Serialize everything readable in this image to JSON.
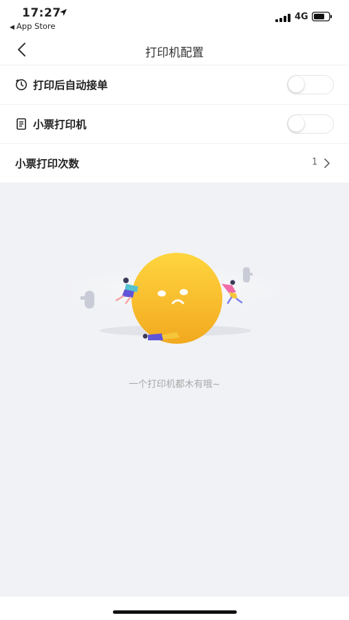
{
  "status": {
    "time": "17:27",
    "back_app": "App Store",
    "network": "4G"
  },
  "nav": {
    "title": "打印机配置"
  },
  "rows": [
    {
      "label": "打印后自动接单",
      "icon": "clock-icon",
      "type": "toggle",
      "on": false
    },
    {
      "label": "小票打印机",
      "icon": "receipt-icon",
      "type": "toggle",
      "on": false
    },
    {
      "label": "小票打印次数",
      "type": "value",
      "value": "1"
    }
  ],
  "empty_state": {
    "message": "一个打印机都木有哦~",
    "illustration": "sad-face-pushing-people-illustration"
  },
  "colors": {
    "accent_yellow": "#f6b92a",
    "background_gray": "#f1f2f5"
  }
}
